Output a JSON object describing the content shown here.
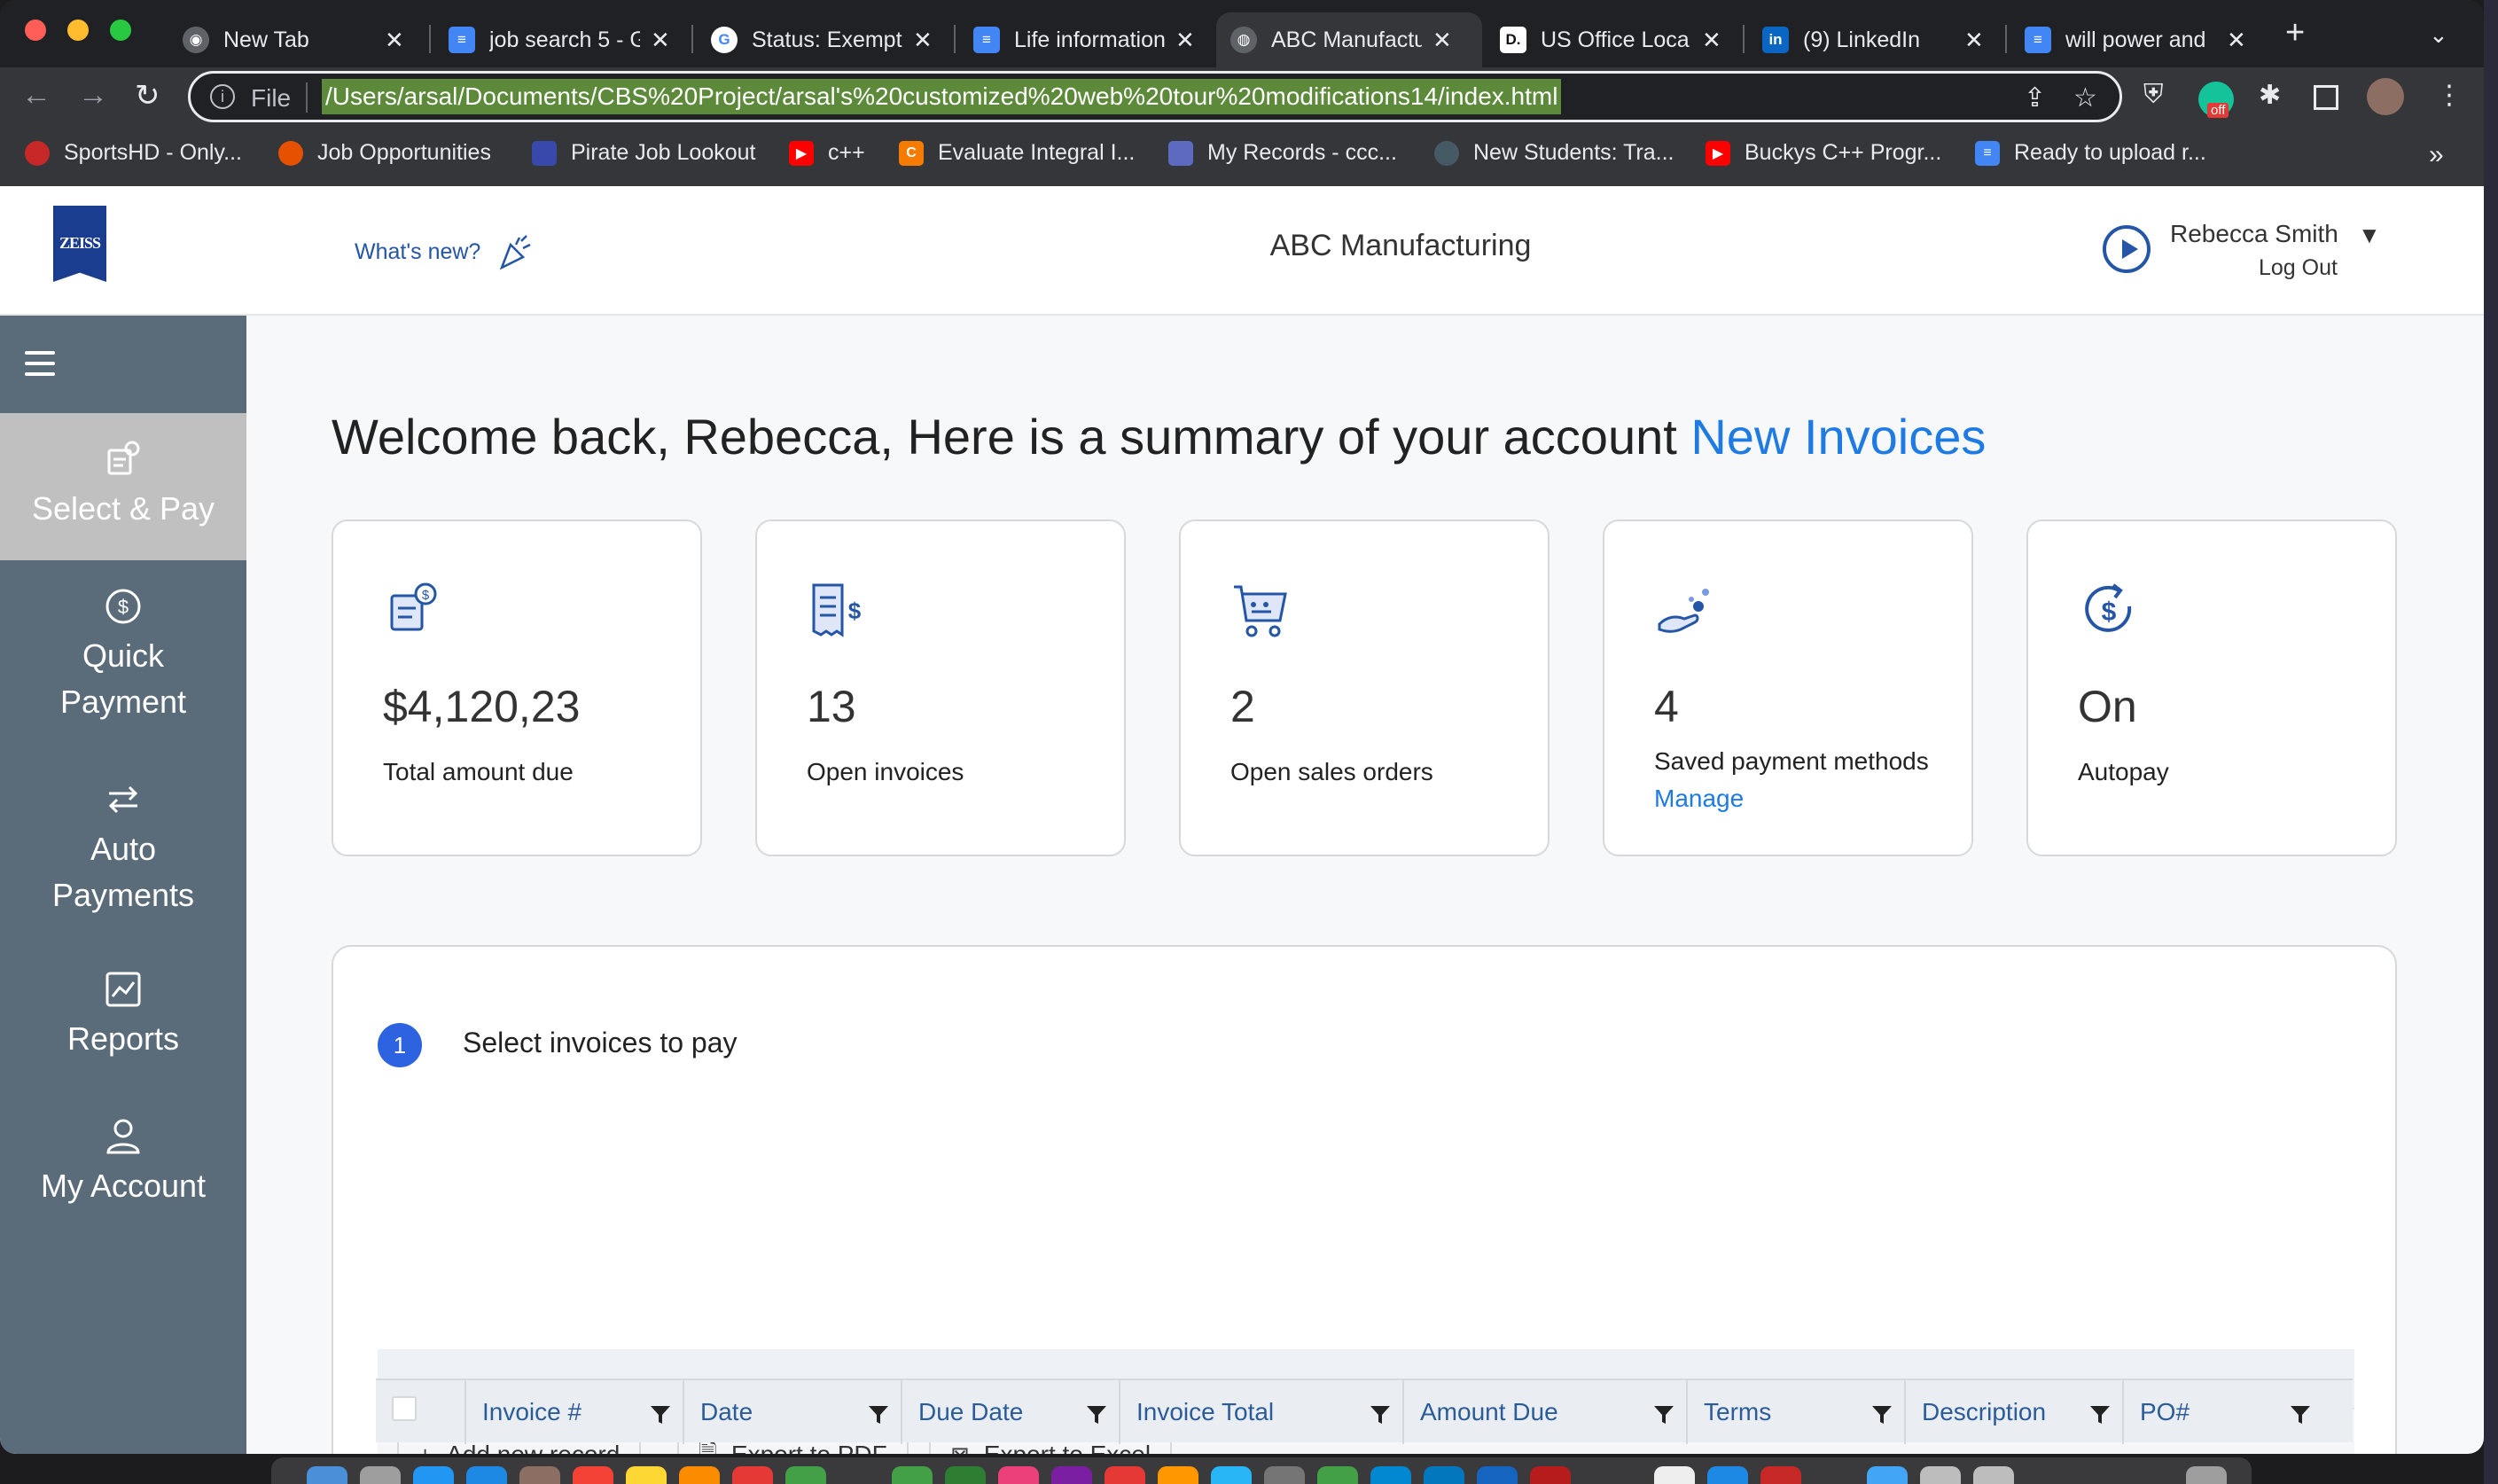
{
  "browser": {
    "tabs": [
      {
        "title": "New Tab",
        "favicon": "chrome-icon",
        "color": "#5f6368"
      },
      {
        "title": "job search 5 - G",
        "favicon": "docs-icon",
        "color": "#4285f4"
      },
      {
        "title": "Status: Exempt",
        "favicon": "google-icon",
        "color": "#ffffff"
      },
      {
        "title": "Life information",
        "favicon": "docs-icon",
        "color": "#4285f4"
      },
      {
        "title": "ABC Manufactu",
        "favicon": "globe-icon",
        "color": "#5f6368"
      },
      {
        "title": "US Office Loca",
        "favicon": "d-icon",
        "color": "#ffffff"
      },
      {
        "title": "(9) LinkedIn",
        "favicon": "linkedin-icon",
        "color": "#0a66c2"
      },
      {
        "title": "will power and",
        "favicon": "docs-icon",
        "color": "#4285f4"
      }
    ],
    "active_tab_index": 4,
    "address": {
      "scheme_label": "File",
      "url": "/Users/arsal/Documents/CBS%20Project/arsal's%20customized%20web%20tour%20modifications14/index.html"
    },
    "extension_badge": "off",
    "bookmarks": [
      {
        "label": "SportsHD - Only...",
        "icon": "sportshd-icon",
        "color": "#c62828"
      },
      {
        "label": "Job Opportunities",
        "icon": "job-icon",
        "color": "#e65100"
      },
      {
        "label": "Pirate Job Lookout",
        "icon": "pirate-icon",
        "color": "#3949ab"
      },
      {
        "label": "c++",
        "icon": "youtube-icon",
        "color": "#ff0000"
      },
      {
        "label": "Evaluate Integral I...",
        "icon": "c-icon",
        "color": "#f57c00"
      },
      {
        "label": "My Records - ccc...",
        "icon": "records-icon",
        "color": "#5c6bc0"
      },
      {
        "label": "New Students: Tra...",
        "icon": "seal-icon",
        "color": "#455a64"
      },
      {
        "label": "Buckys C++ Progr...",
        "icon": "youtube-icon",
        "color": "#ff0000"
      },
      {
        "label": "Ready to upload r...",
        "icon": "docs-icon",
        "color": "#4285f4"
      }
    ],
    "bookmarks_more": "»"
  },
  "header": {
    "logo_text": "ZEISS",
    "whats_new": "What's new?",
    "company": "ABC Manufacturing",
    "user_name": "Rebecca Smith",
    "logout": "Log Out"
  },
  "sidebar": {
    "items": [
      {
        "label": "Select & Pay",
        "icon": "invoice-pay-icon",
        "active": true
      },
      {
        "label": "Quick Payment",
        "icon": "dollar-circle-icon",
        "active": false
      },
      {
        "label": "Auto Payments",
        "icon": "swap-arrows-icon",
        "active": false
      },
      {
        "label": "Reports",
        "icon": "chart-icon",
        "active": false
      },
      {
        "label": "My Account",
        "icon": "user-icon",
        "active": false
      }
    ]
  },
  "welcome": {
    "text": "Welcome back, Rebecca, Here is a summary of your account",
    "link": "New Invoices"
  },
  "cards": [
    {
      "value": "$4,120,23",
      "label": "Total amount due",
      "icon": "money-doc-icon"
    },
    {
      "value": "13",
      "label": "Open invoices",
      "icon": "receipt-icon"
    },
    {
      "value": "2",
      "label": "Open sales orders",
      "icon": "cart-icon"
    },
    {
      "value": "4",
      "label": "Saved payment methods",
      "link": "Manage",
      "icon": "hand-coins-icon"
    },
    {
      "value": "On",
      "label": "Autopay",
      "icon": "autopay-icon"
    }
  ],
  "panel": {
    "step_number": "1",
    "step_title": "Select invoices to pay",
    "toolbar": {
      "add": "Add new record",
      "pdf": "Export to PDF",
      "excel": "Export to Excel"
    },
    "columns": [
      "Invoice #",
      "Date",
      "Due Date",
      "Invoice Total",
      "Amount Due",
      "Terms",
      "Description",
      "PO#"
    ]
  },
  "colors": {
    "accent": "#1e7be3",
    "brand": "#1a3d8f",
    "sidebar": "#5a6b7a",
    "sidebar_active": "#c0c0c0",
    "icon_blue": "#2455a6"
  }
}
